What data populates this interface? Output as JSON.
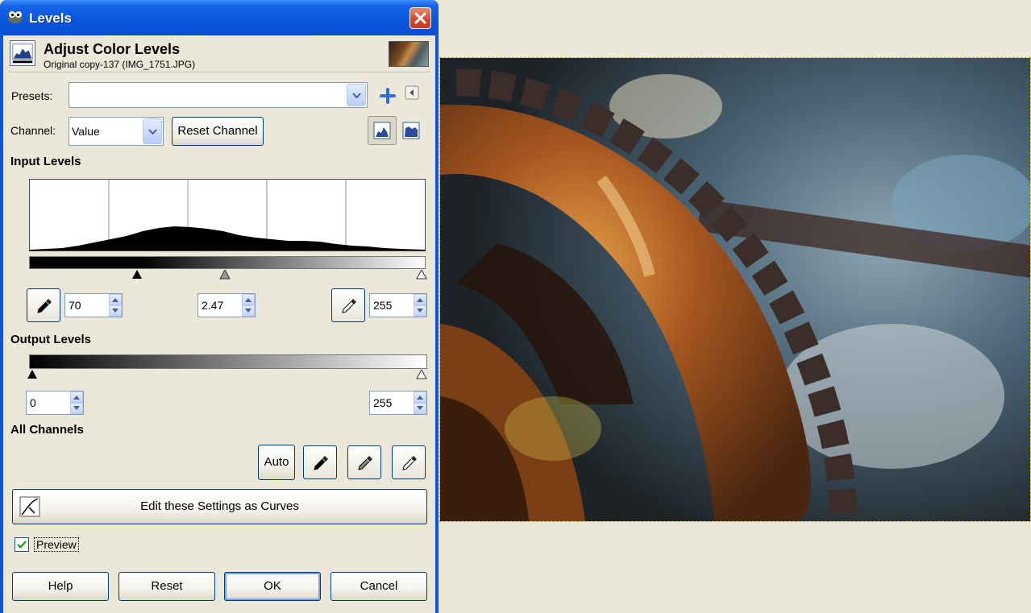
{
  "window": {
    "title": "Levels",
    "icon": "gimp-wilber-icon",
    "close_icon": "close-icon"
  },
  "header": {
    "title": "Adjust Color Levels",
    "subtitle": "Original copy-137 (IMG_1751.JPG)",
    "icon": "levels-icon"
  },
  "presets": {
    "label": "Presets:",
    "value": "",
    "add_icon": "plus-icon",
    "menu_icon": "triangle-left-icon"
  },
  "channel": {
    "label": "Channel:",
    "value": "Value",
    "reset_label": "Reset Channel",
    "linear_icon": "linear-histogram-icon",
    "log_icon": "log-histogram-icon"
  },
  "input_levels": {
    "heading": "Input Levels",
    "low": "70",
    "gamma": "2.47",
    "high": "255",
    "low_value": 70,
    "gamma_value": 2.47,
    "high_value": 255
  },
  "output_levels": {
    "heading": "Output Levels",
    "low": "0",
    "high": "255"
  },
  "all_channels": {
    "heading": "All Channels",
    "auto_label": "Auto",
    "black_picker_icon": "eyedropper-black-icon",
    "gray_picker_icon": "eyedropper-gray-icon",
    "white_picker_icon": "eyedropper-white-icon"
  },
  "curves_button": {
    "label": "Edit these Settings as Curves",
    "icon": "curves-icon"
  },
  "preview": {
    "label": "Preview",
    "checked": true
  },
  "footer": {
    "help": "Help",
    "reset": "Reset",
    "ok": "OK",
    "cancel": "Cancel"
  },
  "colors": {
    "titlebar": "#0a55dc",
    "dialog_bg": "#ebe8d9",
    "close_red": "#d6442a"
  }
}
